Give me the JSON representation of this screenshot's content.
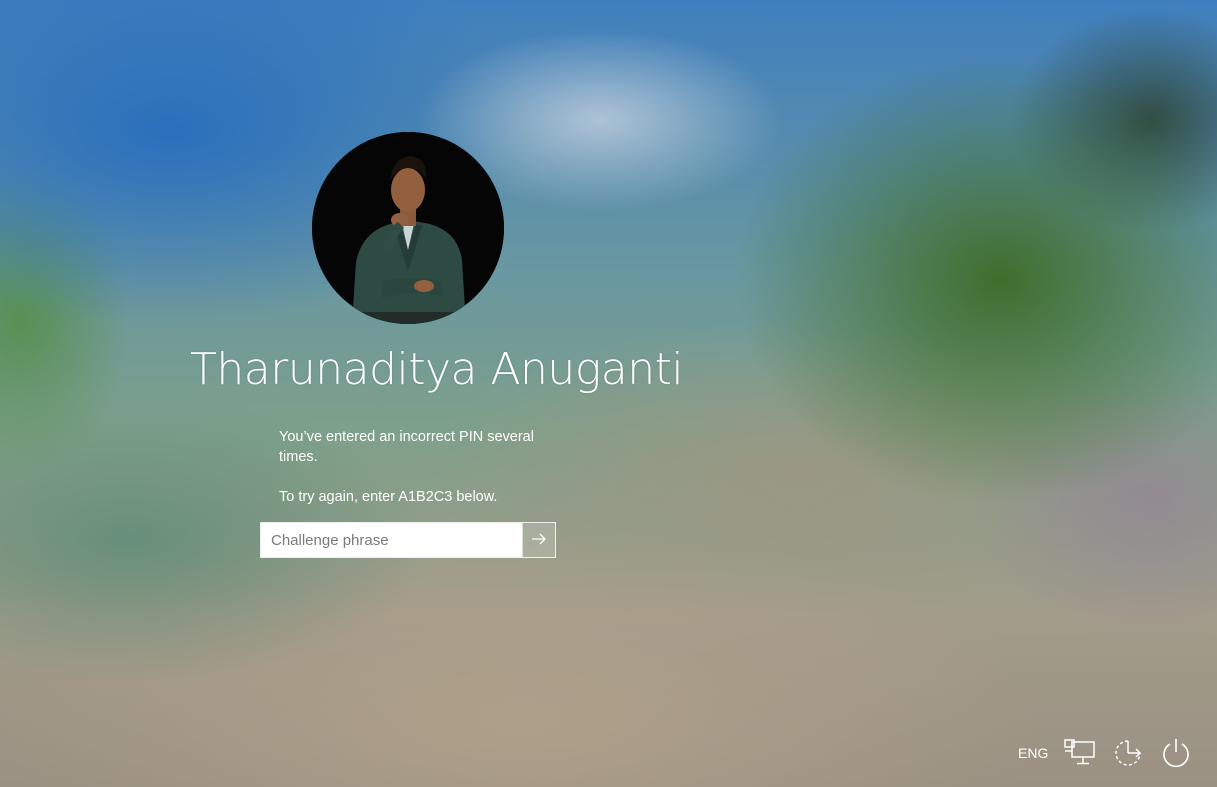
{
  "user": {
    "name": "Tharunaditya Anuganti"
  },
  "message": {
    "line1": "You’ve entered an incorrect PIN several times.",
    "line2": "To try again, enter A1B2C3 below."
  },
  "challenge": {
    "value": "",
    "placeholder": "Challenge phrase",
    "submit_icon": "arrow-right-icon"
  },
  "tray": {
    "language": "ENG",
    "icons": [
      "network-icon",
      "ease-of-access-icon",
      "power-icon"
    ]
  },
  "colors": {
    "text": "#ffffff",
    "input_bg": "#ffffff",
    "placeholder": "#7a7a7a"
  }
}
